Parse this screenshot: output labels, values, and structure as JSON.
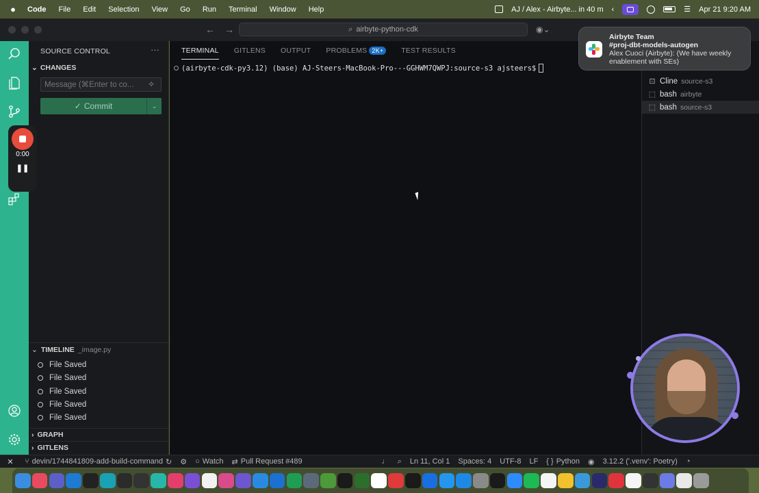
{
  "menubar": {
    "app": "Code",
    "items": [
      "File",
      "Edit",
      "Selection",
      "View",
      "Go",
      "Run",
      "Terminal",
      "Window",
      "Help"
    ],
    "event": "AJ / Alex - Airbyte... in 40 m",
    "datetime": "Apr 21  9:20 AM"
  },
  "titlebar": {
    "command_center": "airbyte-python-cdk"
  },
  "notification": {
    "title": "Airbyte Team",
    "channel": "#proj-dbt-models-autogen",
    "message": "Alex Cuoci (Airbyte): (We have weekly enablement with SEs)"
  },
  "recorder": {
    "time": "0:00",
    "pause_glyph": "❚❚"
  },
  "sidebar": {
    "header": "SOURCE CONTROL",
    "dots": "···",
    "changes": "CHANGES",
    "message_placeholder": "Message (⌘Enter to co...",
    "commit_label": "Commit",
    "commit_check": "✓",
    "timeline": {
      "label": "TIMELINE",
      "file": "_image.py",
      "items": [
        "File Saved",
        "File Saved",
        "File Saved",
        "File Saved",
        "File Saved"
      ]
    },
    "graph": "GRAPH",
    "gitlens": "GITLENS"
  },
  "panel": {
    "tabs": [
      {
        "label": "TERMINAL",
        "active": true
      },
      {
        "label": "GITLENS",
        "active": false
      },
      {
        "label": "OUTPUT",
        "active": false
      },
      {
        "label": "PROBLEMS",
        "active": false,
        "count": "2K+"
      },
      {
        "label": "TEST RESULTS",
        "active": false
      }
    ],
    "prompt": "(airbyte-cdk-py3.12) (base) AJ-Steers-MacBook-Pro---GGHWM7QWPJ:source-s3 ajsteers$"
  },
  "terminals": [
    {
      "name": "Cline",
      "desc": "source-s3",
      "icon": "robot-icon",
      "selected": false
    },
    {
      "name": "bash",
      "desc": "airbyte",
      "icon": "terminal-icon",
      "selected": false
    },
    {
      "name": "bash",
      "desc": "source-s3",
      "icon": "terminal-icon",
      "selected": true
    }
  ],
  "statusbar": {
    "remote": "✕",
    "branch": "devin/1744841809-add-build-command",
    "watch": "Watch",
    "pull_request": "Pull Request #489",
    "position": "Ln 11, Col 1",
    "spaces": "Spaces: 4",
    "encoding": "UTF-8",
    "eol": "LF",
    "language": "Python",
    "interpreter": "3.12.2 ('.venv': Poetry)"
  },
  "dock": {
    "apps": [
      {
        "name": "finder",
        "color": "#3b8de0"
      },
      {
        "name": "launchpad",
        "color": "#e84a5f"
      },
      {
        "name": "teams",
        "color": "#5b5fc7"
      },
      {
        "name": "vscode",
        "color": "#1f7ad2"
      },
      {
        "name": "chatgpt",
        "color": "#222222"
      },
      {
        "name": "browser",
        "color": "#1aa1b3"
      },
      {
        "name": "terminal-alt",
        "color": "#2b2b2b"
      },
      {
        "name": "terminal",
        "color": "#333333"
      },
      {
        "name": "arc",
        "color": "#28b6a8"
      },
      {
        "name": "intellij",
        "color": "#e33e6c"
      },
      {
        "name": "obsidian",
        "color": "#7a4fd6"
      },
      {
        "name": "calendar",
        "color": "#f2f2f2"
      },
      {
        "name": "preview",
        "color": "#d94b8a"
      },
      {
        "name": "linear",
        "color": "#6e56cf"
      },
      {
        "name": "xcode",
        "color": "#2a8ae0"
      },
      {
        "name": "clion",
        "color": "#1b70d0"
      },
      {
        "name": "sheets",
        "color": "#1f9d55"
      },
      {
        "name": "screen",
        "color": "#5a6a7a"
      },
      {
        "name": "minecraft",
        "color": "#4c9a3a"
      },
      {
        "name": "console",
        "color": "#1a1a1a"
      },
      {
        "name": "vim",
        "color": "#2c6e2c"
      },
      {
        "name": "notion",
        "color": "#ffffff"
      },
      {
        "name": "pdf",
        "color": "#e03a3a"
      },
      {
        "name": "jetbrains",
        "color": "#1a1a1a"
      },
      {
        "name": "1password",
        "color": "#1a6fe0"
      },
      {
        "name": "docker",
        "color": "#2496ed"
      },
      {
        "name": "appstore",
        "color": "#1e88e5"
      },
      {
        "name": "settings",
        "color": "#8a8a8a"
      },
      {
        "name": "audio",
        "color": "#1a1a1a"
      },
      {
        "name": "zoom",
        "color": "#2d8cff"
      },
      {
        "name": "spotify",
        "color": "#1db954"
      },
      {
        "name": "calendar2",
        "color": "#f5f5f5"
      },
      {
        "name": "cyberduck",
        "color": "#f2c12e"
      },
      {
        "name": "files",
        "color": "#3a9ad9"
      },
      {
        "name": "ai",
        "color": "#2a2a6a"
      },
      {
        "name": "todo",
        "color": "#e0343d"
      },
      {
        "name": "github",
        "color": "#f5f5f5"
      },
      {
        "name": "obs",
        "color": "#333333"
      },
      {
        "name": "screenshot",
        "color": "#6c7be6"
      },
      {
        "name": "document",
        "color": "#e8e8e8"
      },
      {
        "name": "trash",
        "color": "#9a9a9a"
      }
    ]
  }
}
